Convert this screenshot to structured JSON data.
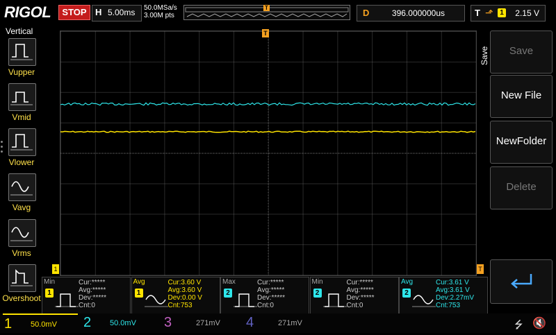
{
  "topbar": {
    "brand": "RIGOL",
    "run_state": "STOP",
    "horizontal": {
      "key": "H",
      "timebase": "5.00ms"
    },
    "sample_rate": "50.0MSa/s",
    "memory_depth": "3.00M pts",
    "delay": {
      "key": "D",
      "value": "396.000000us"
    },
    "trigger": {
      "key": "T",
      "source": "1",
      "level": "2.15 V"
    }
  },
  "left_panel": {
    "title": "Vertical",
    "items": [
      {
        "label": "Vupper"
      },
      {
        "label": "Vmid"
      },
      {
        "label": "Vlower"
      },
      {
        "label": "Vavg"
      },
      {
        "label": "Vrms"
      },
      {
        "label": "Overshoot"
      }
    ]
  },
  "right_panel": {
    "tab_label": "Save",
    "buttons": [
      {
        "label": "Save",
        "enabled": false
      },
      {
        "label": "New File",
        "enabled": true
      },
      {
        "label": "NewFolder",
        "enabled": true
      },
      {
        "label": "Delete",
        "enabled": false
      }
    ]
  },
  "measurements": [
    {
      "title": "Min",
      "channel": "1",
      "lines": [
        "Cur:*****",
        "Avg:*****",
        "Dev:*****",
        "Cnt:0"
      ],
      "color": "#aaaaaa"
    },
    {
      "title": "Avg",
      "channel": "1",
      "lines": [
        "Cur:3.60 V",
        "Avg:3.60 V",
        "Dev:0.00 V",
        "Cnt:753"
      ],
      "color": "#ffe400"
    },
    {
      "title": "Max",
      "channel": "2",
      "lines": [
        "Cur:*****",
        "Avg:*****",
        "Dev:*****",
        "Cnt:0"
      ],
      "color": "#aaaaaa"
    },
    {
      "title": "Min",
      "channel": "2",
      "lines": [
        "Cur:*****",
        "Avg:*****",
        "Dev:*****",
        "Cnt:0"
      ],
      "color": "#aaaaaa"
    },
    {
      "title": "Avg",
      "channel": "2",
      "lines": [
        "Cur:3.61 V",
        "Avg:3.61 V",
        "Dev:2.27mV",
        "Cnt:753"
      ],
      "color": "#2ee6ea"
    }
  ],
  "channels": [
    {
      "num": "1",
      "scale": "50.0mV",
      "color": "#ffe400"
    },
    {
      "num": "2",
      "scale": "50.0mV",
      "color": "#2ee6ea"
    },
    {
      "num": "3",
      "scale": "271mV",
      "color": "#c060c0"
    },
    {
      "num": "4",
      "scale": "271mV",
      "color": "#6060c0"
    }
  ],
  "colors": {
    "ch1": "#ffe400",
    "ch2": "#2ee6ea",
    "trigger": "#f4a020",
    "stop": "#c41c1c"
  }
}
